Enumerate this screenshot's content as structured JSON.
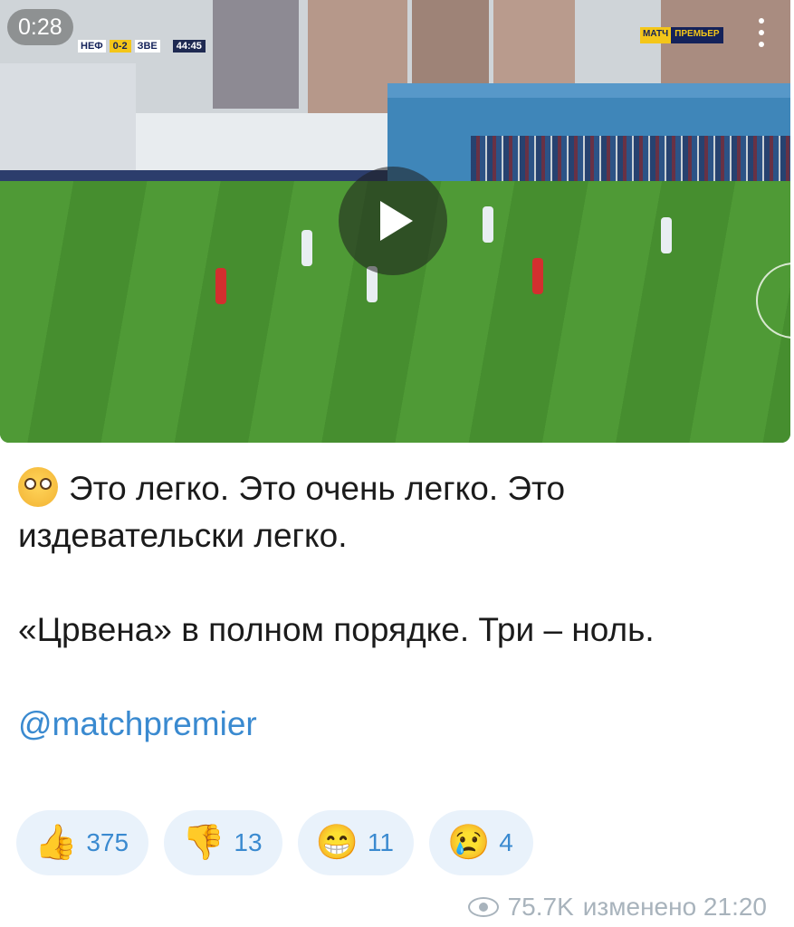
{
  "video": {
    "duration": "0:28",
    "scoreboard": {
      "home": "НЕФ",
      "score": "0-2",
      "away": "ЗВЕ",
      "time": "44:45"
    },
    "broadcaster": {
      "left": "МАТЧ",
      "right": "ПРЕМЬЕР"
    },
    "play_icon": "play-icon",
    "menu_icon": "more-vertical-icon"
  },
  "message": {
    "reaction_emoji": "😳",
    "line1": "Это легко. Это очень легко. Это издевательски легко.",
    "line2": "«Црвена» в полном порядке. Три – ноль.",
    "link": "@matchpremier"
  },
  "reactions": [
    {
      "emoji": "👍",
      "count": "375",
      "icon": "thumbs-up-icon"
    },
    {
      "emoji": "👎",
      "count": "13",
      "icon": "thumbs-down-icon"
    },
    {
      "emoji": "😁",
      "count": "11",
      "icon": "grinning-face-icon"
    },
    {
      "emoji": "😢",
      "count": "4",
      "icon": "crying-face-icon"
    }
  ],
  "footer": {
    "views": "75.7K",
    "edited": "изменено 21:20"
  }
}
